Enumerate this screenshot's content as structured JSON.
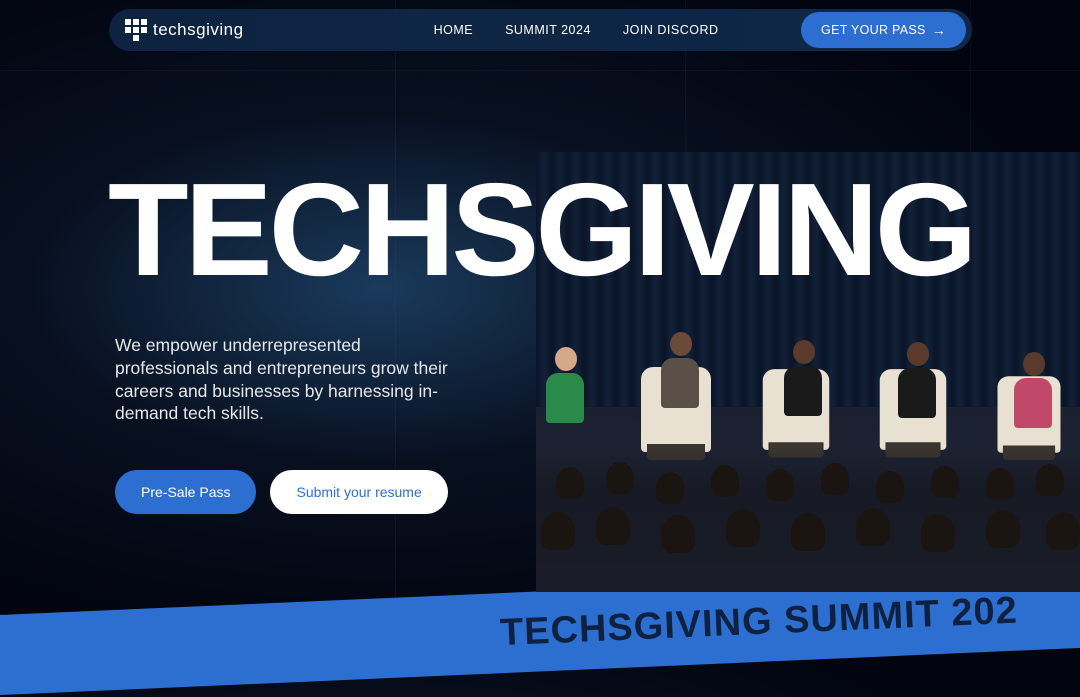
{
  "brand": {
    "name": "techsgiving"
  },
  "nav": {
    "items": [
      "HOME",
      "SUMMIT 2024",
      "JOIN DISCORD"
    ],
    "cta": "GET YOUR PASS"
  },
  "hero": {
    "title": "TECHSGIVING",
    "description": "We empower underrepresented professionals and entrepreneurs grow their careers and businesses by harnessing in-demand tech skills.",
    "primary_btn": "Pre-Sale Pass",
    "secondary_btn": "Submit your resume"
  },
  "banner": {
    "text": "TECHSGIVING SUMMIT 202"
  }
}
